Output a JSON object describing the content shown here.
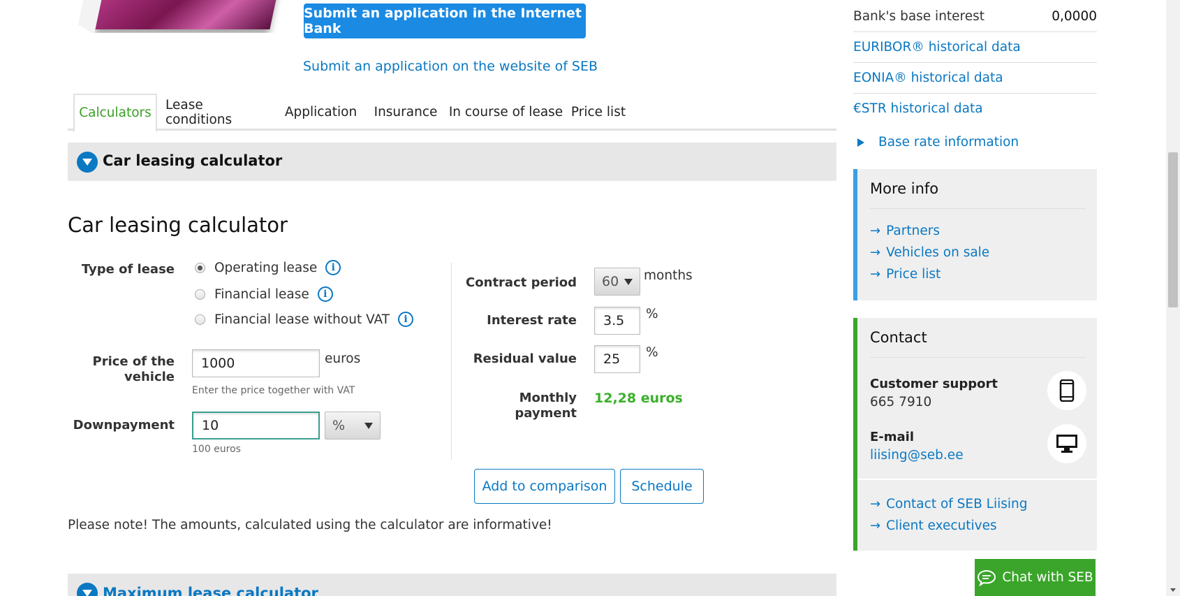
{
  "hero": {
    "primary_button": "Submit an application in the Internet Bank",
    "secondary_link": "Submit an application on the website of SEB"
  },
  "tabs": [
    {
      "label": "Calculators",
      "active": true
    },
    {
      "label": "Lease conditions"
    },
    {
      "label": "Application"
    },
    {
      "label": "Insurance"
    },
    {
      "label": "In course of lease"
    },
    {
      "label": "Price list"
    }
  ],
  "accordion": {
    "car_leasing": "Car leasing calculator",
    "maximum_lease": "Maximum lease calculator"
  },
  "calculator": {
    "title": "Car leasing calculator",
    "type_of_lease_label": "Type of lease",
    "lease_options": [
      "Operating lease",
      "Financial lease",
      "Financial lease without VAT"
    ],
    "selected_lease": "Operating lease",
    "price_label_line1": "Price of the",
    "price_label_line2": "vehicle",
    "price_value": "1000",
    "price_unit": "euros",
    "price_hint": "Enter the price together with VAT",
    "downpayment_label": "Downpayment",
    "downpayment_value": "10",
    "downpayment_unit": "%",
    "downpayment_hint": "100 euros",
    "contract_period_label": "Contract period",
    "contract_period_value": "60",
    "contract_period_unit": "months",
    "interest_rate_label": "Interest rate",
    "interest_rate_value": "3.5",
    "interest_rate_unit": "%",
    "residual_value_label": "Residual value",
    "residual_value_value": "25",
    "residual_value_unit": "%",
    "monthly_payment_label_line1": "Monthly",
    "monthly_payment_label_line2": "payment",
    "monthly_payment_value": "12,28 euros",
    "add_to_comparison": "Add to comparison",
    "schedule": "Schedule",
    "note": "Please note! The amounts, calculated using the calculator are informative!"
  },
  "sidebar": {
    "base_interest_label": "Bank's base interest",
    "base_interest_value": "0,0000",
    "links": [
      "EURIBOR® historical data",
      "EONIA® historical data",
      "€STR historical data"
    ],
    "base_rate_info": "Base rate information",
    "more_info": {
      "title": "More info",
      "links": [
        "Partners",
        "Vehicles on sale",
        "Price list"
      ]
    },
    "contact": {
      "title": "Contact",
      "support_label": "Customer support",
      "support_phone": "665 7910",
      "email_label": "E-mail",
      "email": "liising@seb.ee",
      "links": [
        "Contact of SEB Liising",
        "Client executives"
      ]
    }
  },
  "chat": {
    "label": "Chat with SEB"
  },
  "colors": {
    "brand_blue": "#0a78c2",
    "button_blue": "#1a8ae3",
    "green": "#3aa52a",
    "result_green": "#3ab02a"
  }
}
